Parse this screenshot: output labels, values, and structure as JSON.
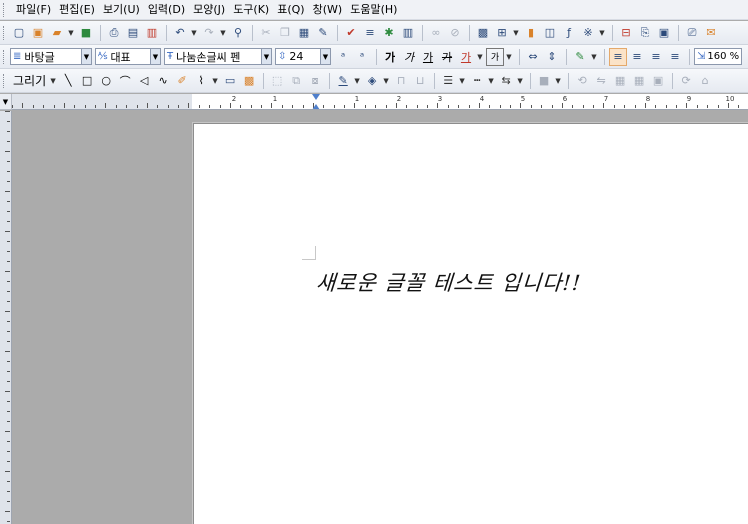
{
  "menubar": {
    "items": [
      "파일(F)",
      "편집(E)",
      "보기(U)",
      "입력(D)",
      "모양(J)",
      "도구(K)",
      "표(Q)",
      "창(W)",
      "도움말(H)"
    ]
  },
  "format_toolbar": {
    "style_name": "바탕글",
    "language": "대표",
    "font_name": "나눔손글씨 펜",
    "font_size": "24",
    "bold": "가",
    "italic": "가",
    "underline": "가",
    "strike": "가",
    "font_color": "가",
    "highlight": "가",
    "zoom": "160 %"
  },
  "draw_toolbar": {
    "label": "그리기"
  },
  "ruler": {
    "h_numbers": [
      "2",
      "1",
      "1",
      "2",
      "3",
      "4",
      "5",
      "6",
      "7",
      "8",
      "9",
      "10"
    ]
  },
  "document": {
    "text": "새로운 글꼴 테스트 입니다!!"
  },
  "colors": {
    "menubar_bg": "#f0f2f6",
    "workspace_bg": "#ababab",
    "accent": "#2c4a7a"
  }
}
